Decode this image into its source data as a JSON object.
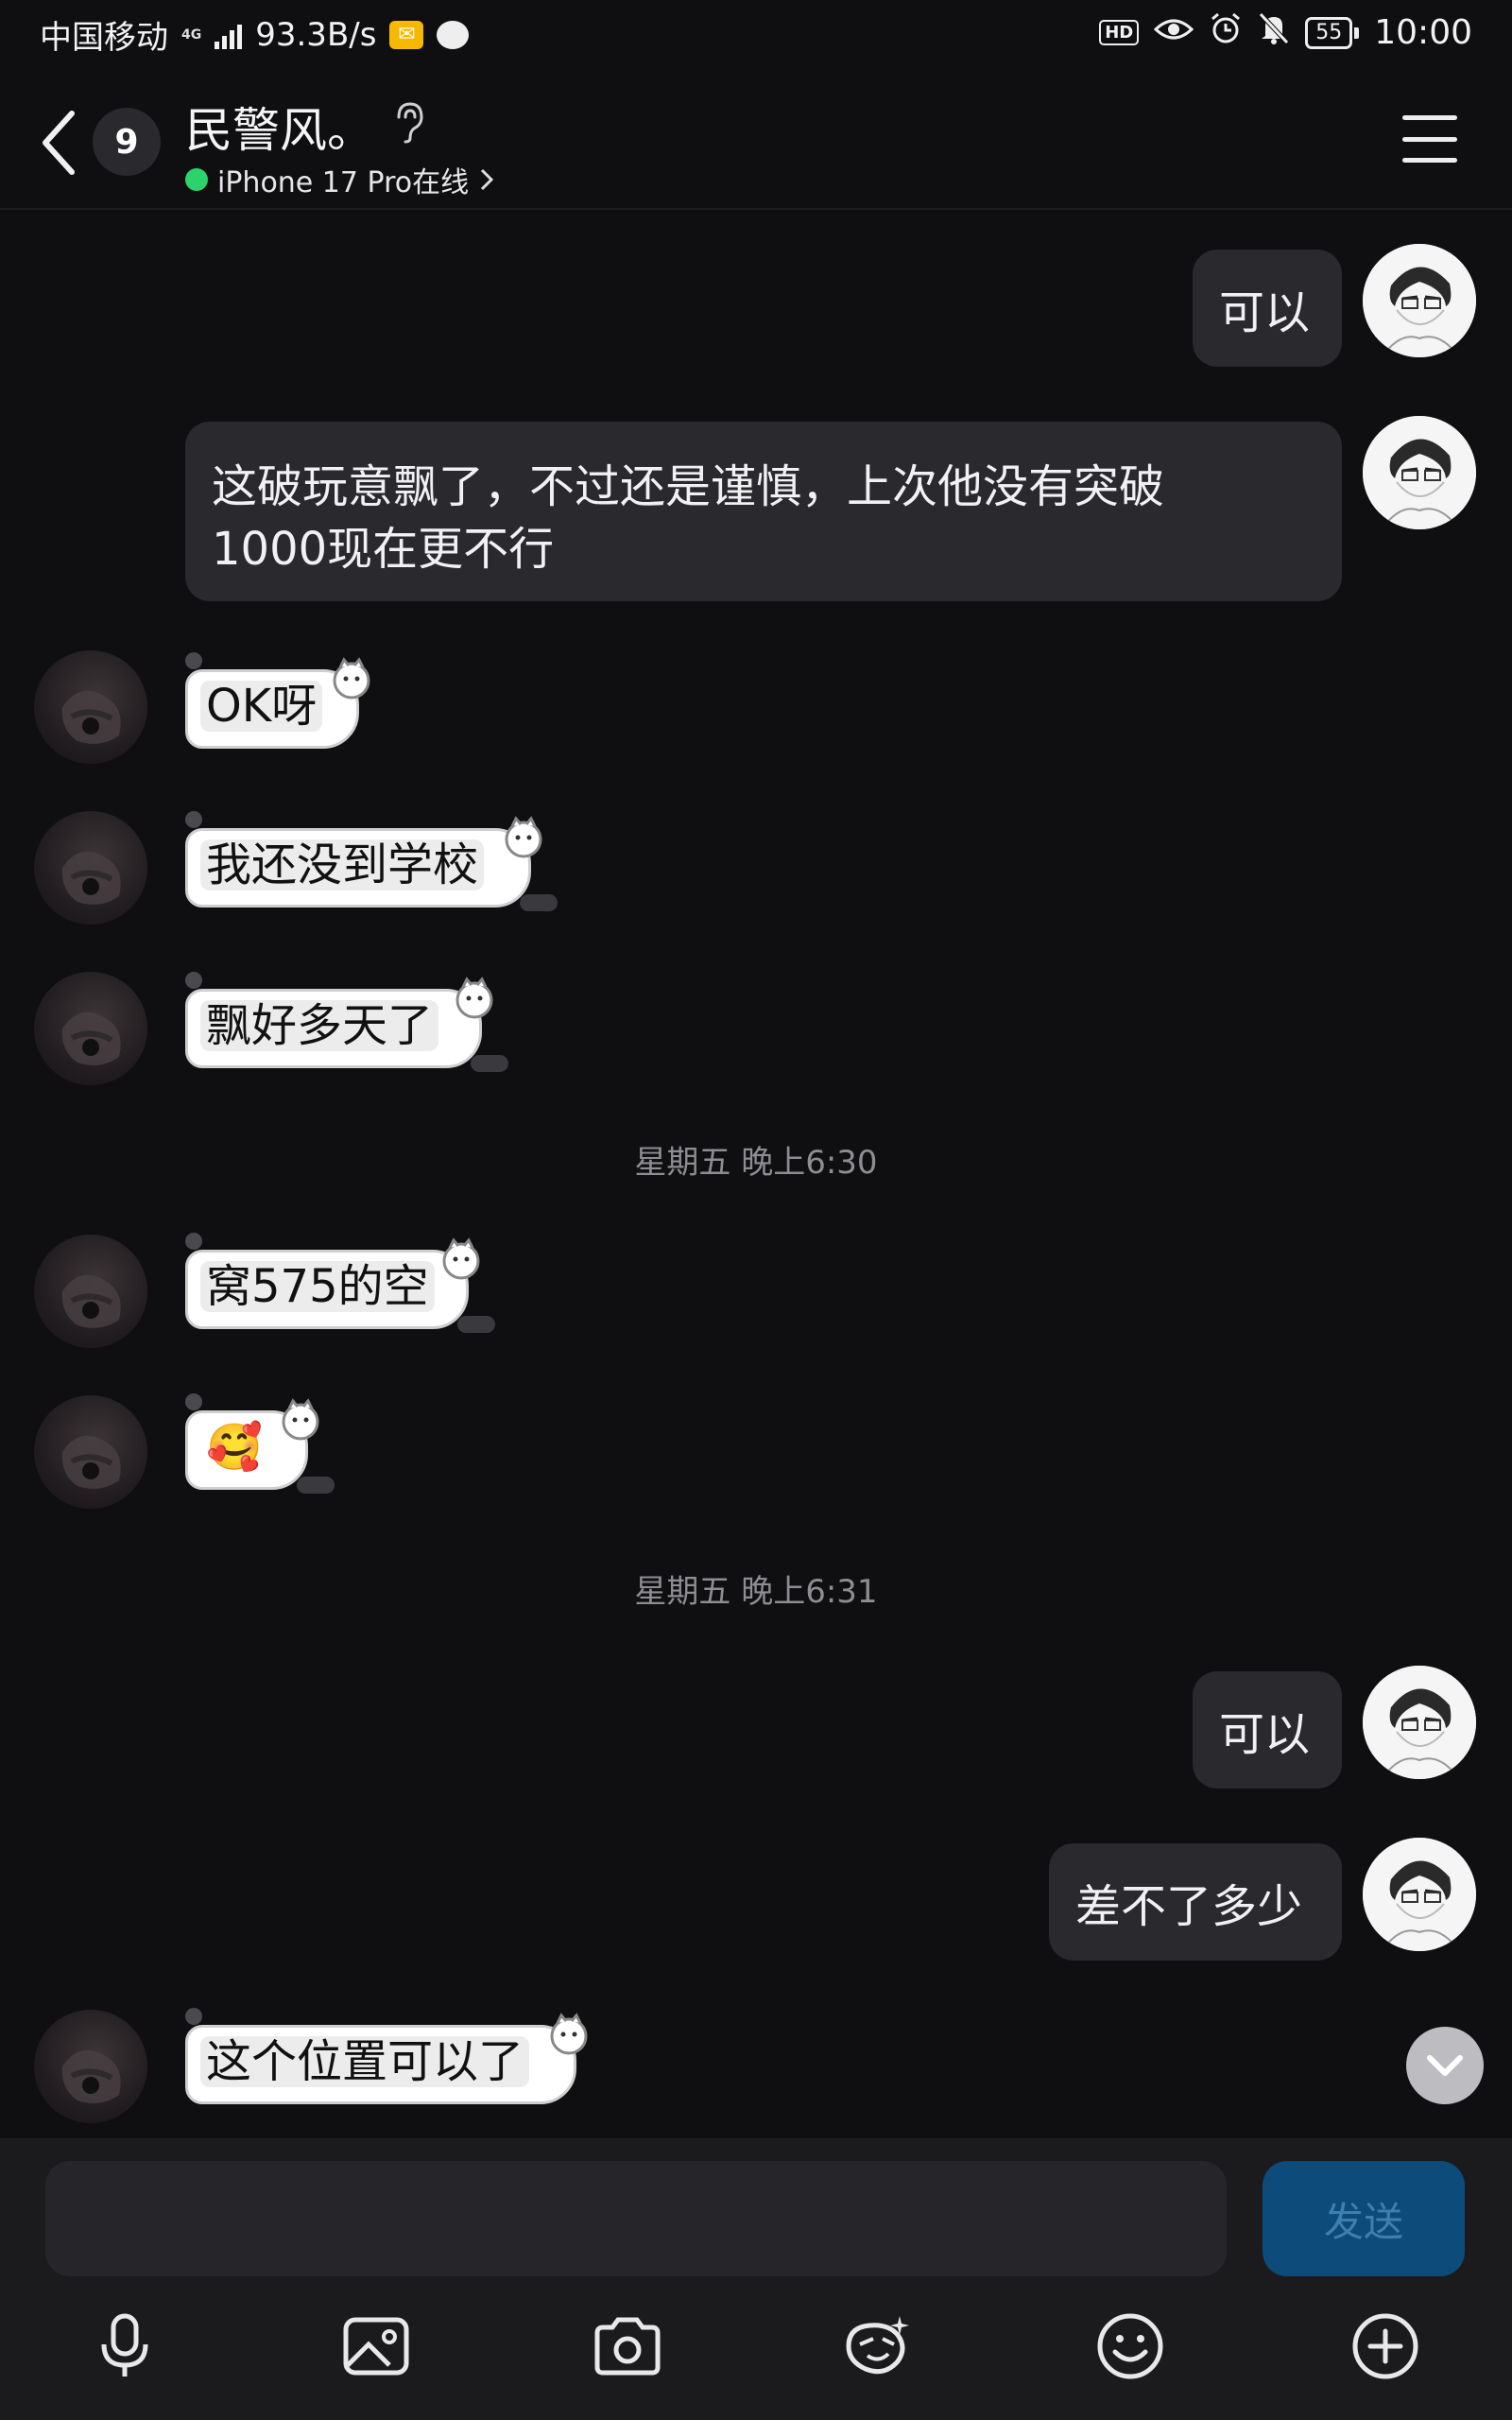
{
  "status_bar": {
    "carrier": "中国移动",
    "network": "4G",
    "speed": "93.3B/s",
    "battery": "55",
    "time": "10:00",
    "hd": "HD",
    "icons": [
      "signal-icon",
      "mail-notification-icon",
      "chat-notification-icon",
      "hd-icon",
      "eye-icon",
      "alarm-icon",
      "mute-icon",
      "battery-icon"
    ]
  },
  "header": {
    "unread_count": "9",
    "title": "民警风。",
    "status_text": "iPhone 17 Pro在线",
    "status_color": "#2bd46a"
  },
  "messages": [
    {
      "side": "me",
      "text": "可以"
    },
    {
      "side": "me",
      "text": "这破玩意飘了，不过还是谨慎，上次他没有突破",
      "text2": "1000现在更不行"
    },
    {
      "side": "them",
      "text": "OK呀"
    },
    {
      "side": "them",
      "text": "我还没到学校"
    },
    {
      "side": "them",
      "text": "飘好多天了"
    },
    {
      "type": "timestamp",
      "text": "星期五 晚上6:30"
    },
    {
      "side": "them",
      "text": "窝575的空"
    },
    {
      "side": "them",
      "emoji": "🥰",
      "emoji_name": "hugging-face-emoji"
    },
    {
      "type": "timestamp",
      "text": "星期五 晚上6:31"
    },
    {
      "side": "me",
      "text": "可以"
    },
    {
      "side": "me",
      "text": "差不了多少"
    },
    {
      "side": "them",
      "text": "这个位置可以了"
    }
  ],
  "input": {
    "placeholder": "",
    "value": "",
    "send_label": "发送"
  },
  "toolbar": [
    "microphone-icon",
    "image-icon",
    "camera-icon",
    "sticker-icon",
    "emoji-icon",
    "add-icon"
  ],
  "colors": {
    "background": "#0f0f11",
    "bubble_me": "#2a2a2e",
    "send_button": "#0d4b7a",
    "timestamp": "#8d8d92"
  }
}
